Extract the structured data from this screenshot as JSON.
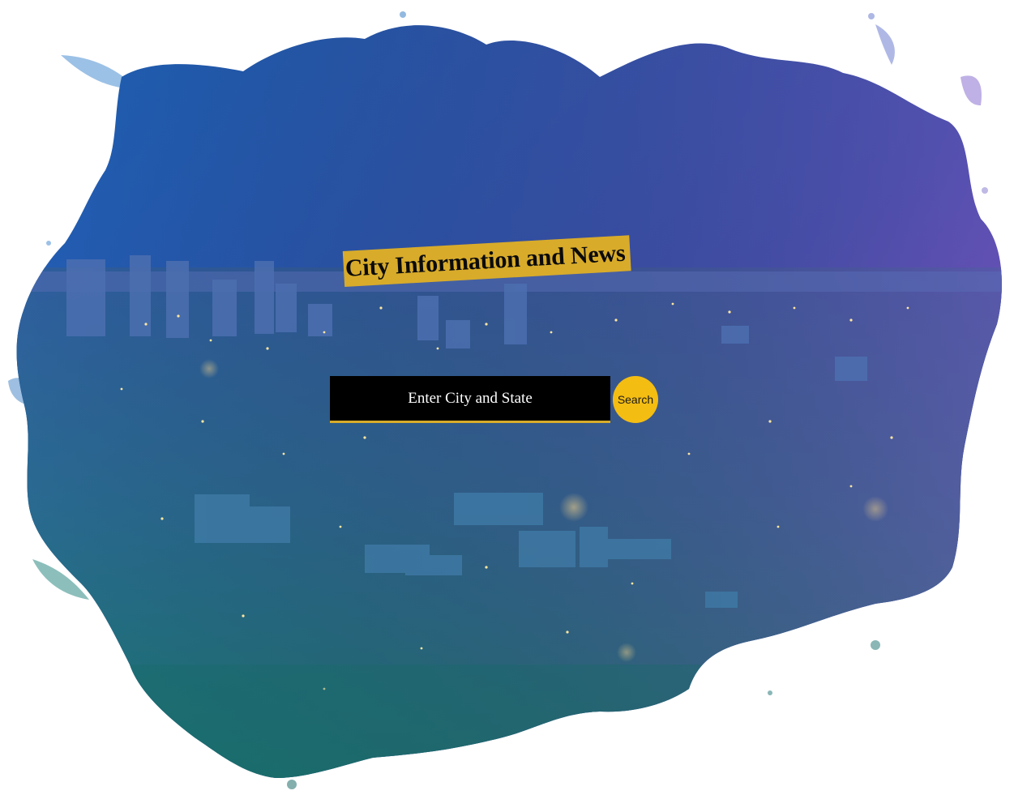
{
  "header": {
    "title": "City Information and News"
  },
  "search": {
    "placeholder": "Enter City and State",
    "value": "",
    "button_label": "Search"
  },
  "theme": {
    "accent": "#d8ab2a",
    "button": "#f4bd12",
    "sky_top": "#1f5fb4",
    "sky_right": "#6a4bb8",
    "city_bottom": "#1e7a78"
  }
}
